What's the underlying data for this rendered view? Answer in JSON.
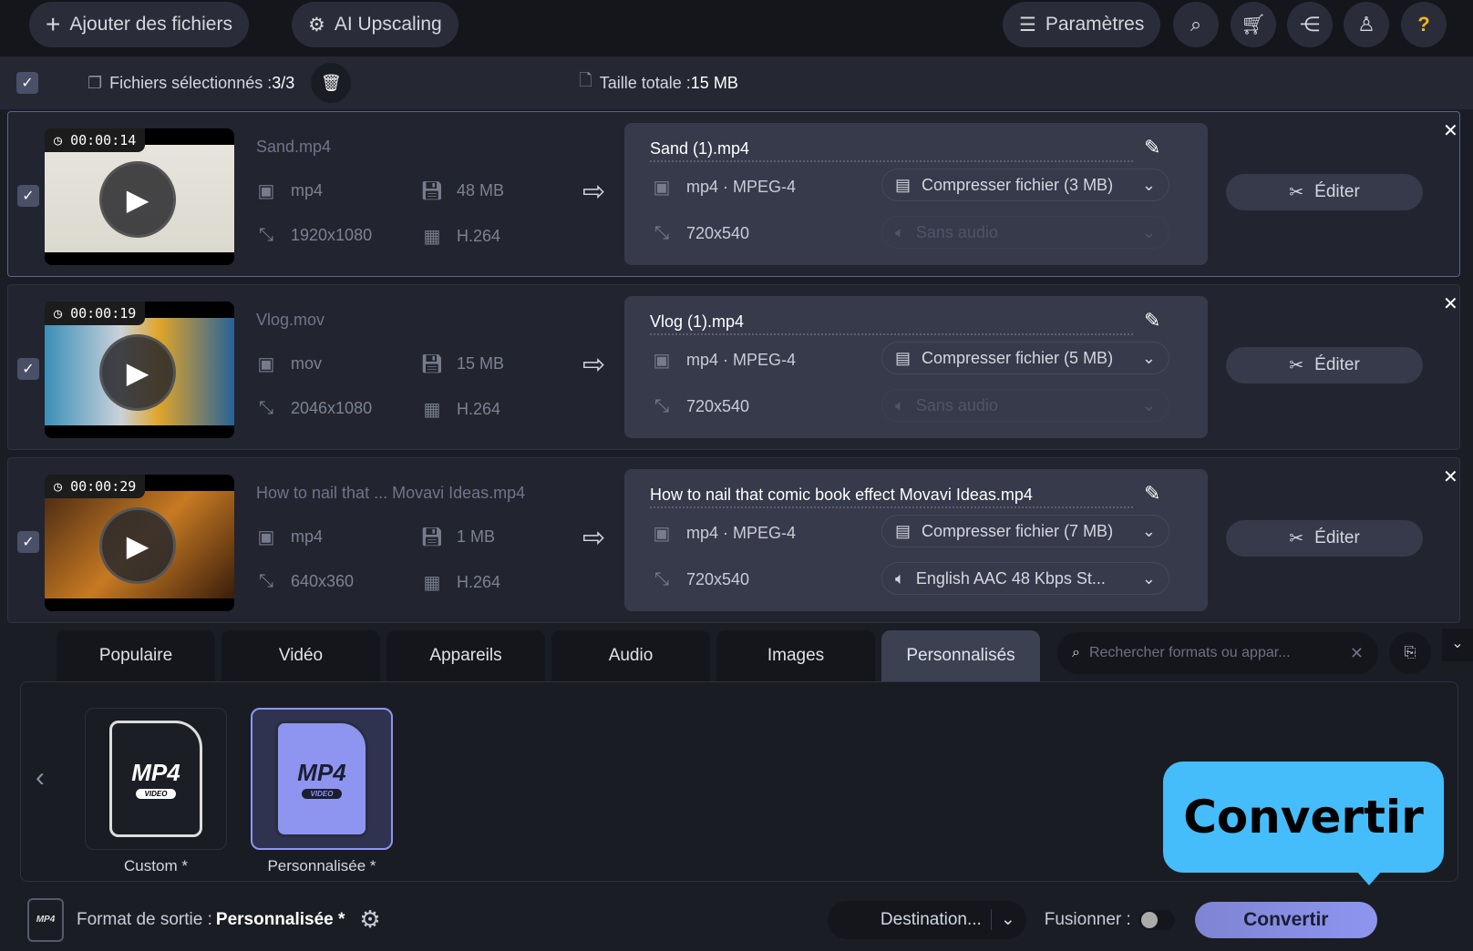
{
  "toolbar": {
    "add_files": "Ajouter des fichiers",
    "ai_upscaling": "AI Upscaling",
    "settings": "Paramètres"
  },
  "selection": {
    "label": "Fichiers sélectionnés : ",
    "count": "3/3",
    "total_label": "Taille totale : ",
    "total": "15 MB"
  },
  "files": [
    {
      "duration": "00:00:14",
      "name": "Sand.mp4",
      "format": "mp4",
      "size": "48 MB",
      "resolution": "1920x1080",
      "codec": "H.264",
      "out_name": "Sand (1).mp4",
      "out_format": "mp4 · MPEG-4",
      "compress": "Compresser fichier (3 MB)",
      "out_res": "720x540",
      "audio": "Sans audio",
      "audio_disabled": true,
      "edit": "Éditer"
    },
    {
      "duration": "00:00:19",
      "name": "Vlog.mov",
      "format": "mov",
      "size": "15 MB",
      "resolution": "2046x1080",
      "codec": "H.264",
      "out_name": "Vlog (1).mp4",
      "out_format": "mp4 · MPEG-4",
      "compress": "Compresser fichier (5 MB)",
      "out_res": "720x540",
      "audio": "Sans audio",
      "audio_disabled": true,
      "edit": "Éditer"
    },
    {
      "duration": "00:00:29",
      "name": "How to nail that ... Movavi Ideas.mp4",
      "format": "mp4",
      "size": "1 MB",
      "resolution": "640x360",
      "codec": "H.264",
      "out_name": "How to nail that comic book effect  Movavi Ideas.mp4",
      "out_format": "mp4 · MPEG-4",
      "compress": "Compresser fichier (7 MB)",
      "out_res": "720x540",
      "audio": "English AAC 48 Kbps St...",
      "audio_disabled": false,
      "edit": "Éditer"
    }
  ],
  "tabs": [
    "Populaire",
    "Vidéo",
    "Appareils",
    "Audio",
    "Images",
    "Personnalisés"
  ],
  "active_tab": "Personnalisés",
  "search": {
    "placeholder": "Rechercher formats ou appar..."
  },
  "formats": [
    {
      "icon_text": "MP4",
      "icon_sub": "VIDEO",
      "label": "Custom *"
    },
    {
      "icon_text": "MP4",
      "icon_sub": "VIDEO",
      "label": "Personnalisée *"
    }
  ],
  "tooltip": "Convertir",
  "bottom": {
    "output_label": "Format de sortie : ",
    "output_value": "Personnalisée *",
    "destination": "Destination...",
    "merge": "Fusionner :",
    "convert": "Convertir",
    "format_badge": "MP4"
  },
  "colors": {
    "accent": "#8d95f0",
    "tooltip": "#45bdfa"
  }
}
